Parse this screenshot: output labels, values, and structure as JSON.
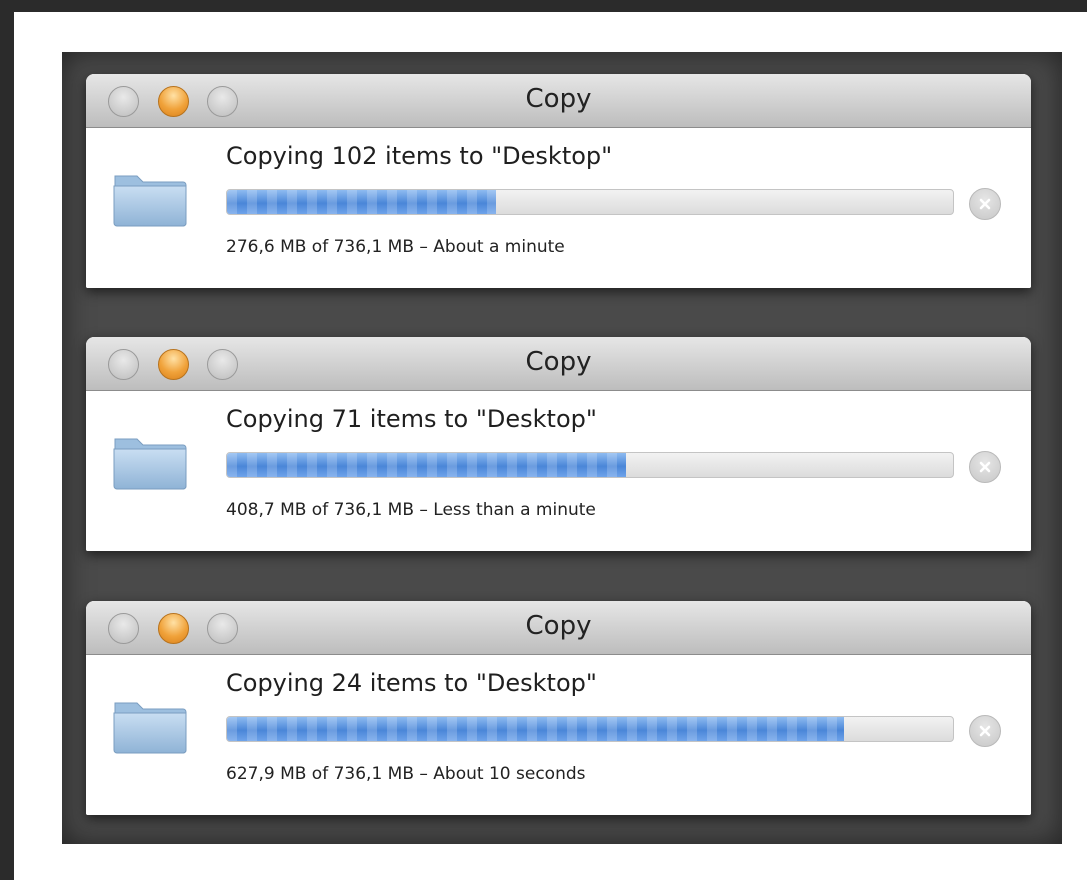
{
  "windows": [
    {
      "title": "Copy",
      "heading": "Copying 102 items to \"Desktop\"",
      "status": "276,6 MB of 736,1 MB – About a minute",
      "progress": 0.37
    },
    {
      "title": "Copy",
      "heading": "Copying 71 items to \"Desktop\"",
      "status": "408,7 MB of 736,1 MB – Less than a minute",
      "progress": 0.55
    },
    {
      "title": "Copy",
      "heading": "Copying 24 items to \"Desktop\"",
      "status": "627,9 MB of 736,1 MB – About 10 seconds",
      "progress": 0.85
    }
  ],
  "icons": {
    "folder": "folder-icon",
    "stop": "stop-icon",
    "close": "close-icon",
    "minimize": "minimize-icon",
    "zoom": "zoom-icon"
  },
  "colors": {
    "progress_fill": "#4a86d8",
    "minimize_button": "#f0a23a"
  }
}
